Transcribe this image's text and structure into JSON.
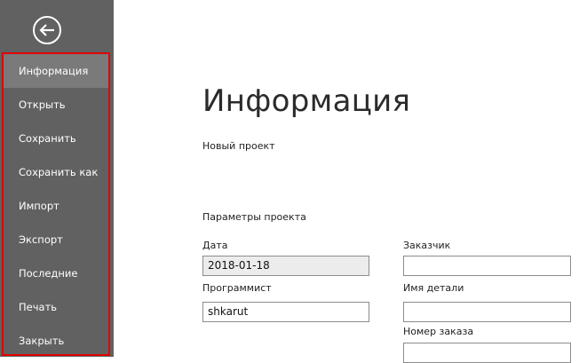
{
  "sidebar": {
    "back_icon": "back-arrow-icon",
    "items": [
      {
        "label": "Информация",
        "active": true
      },
      {
        "label": "Открыть"
      },
      {
        "label": "Сохранить"
      },
      {
        "label": "Сохранить как"
      },
      {
        "label": "Импорт"
      },
      {
        "label": "Экспорт"
      },
      {
        "label": "Последние"
      },
      {
        "label": "Печать"
      },
      {
        "label": "Закрыть"
      }
    ]
  },
  "main": {
    "title": "Информация",
    "project_name": "Новый проект",
    "section_title": "Параметры проекта",
    "fields": {
      "date": {
        "label": "Дата",
        "value": "2018-01-18"
      },
      "programmer": {
        "label": "Программист",
        "value": "shkarut"
      },
      "customer": {
        "label": "Заказчик",
        "value": ""
      },
      "part_name": {
        "label": "Имя детали",
        "value": ""
      },
      "order_number": {
        "label": "Номер заказа",
        "value": ""
      }
    }
  },
  "colors": {
    "sidebar_bg": "#616161",
    "active_item_bg": "#7a7a7a",
    "highlight_border": "#e00000"
  }
}
